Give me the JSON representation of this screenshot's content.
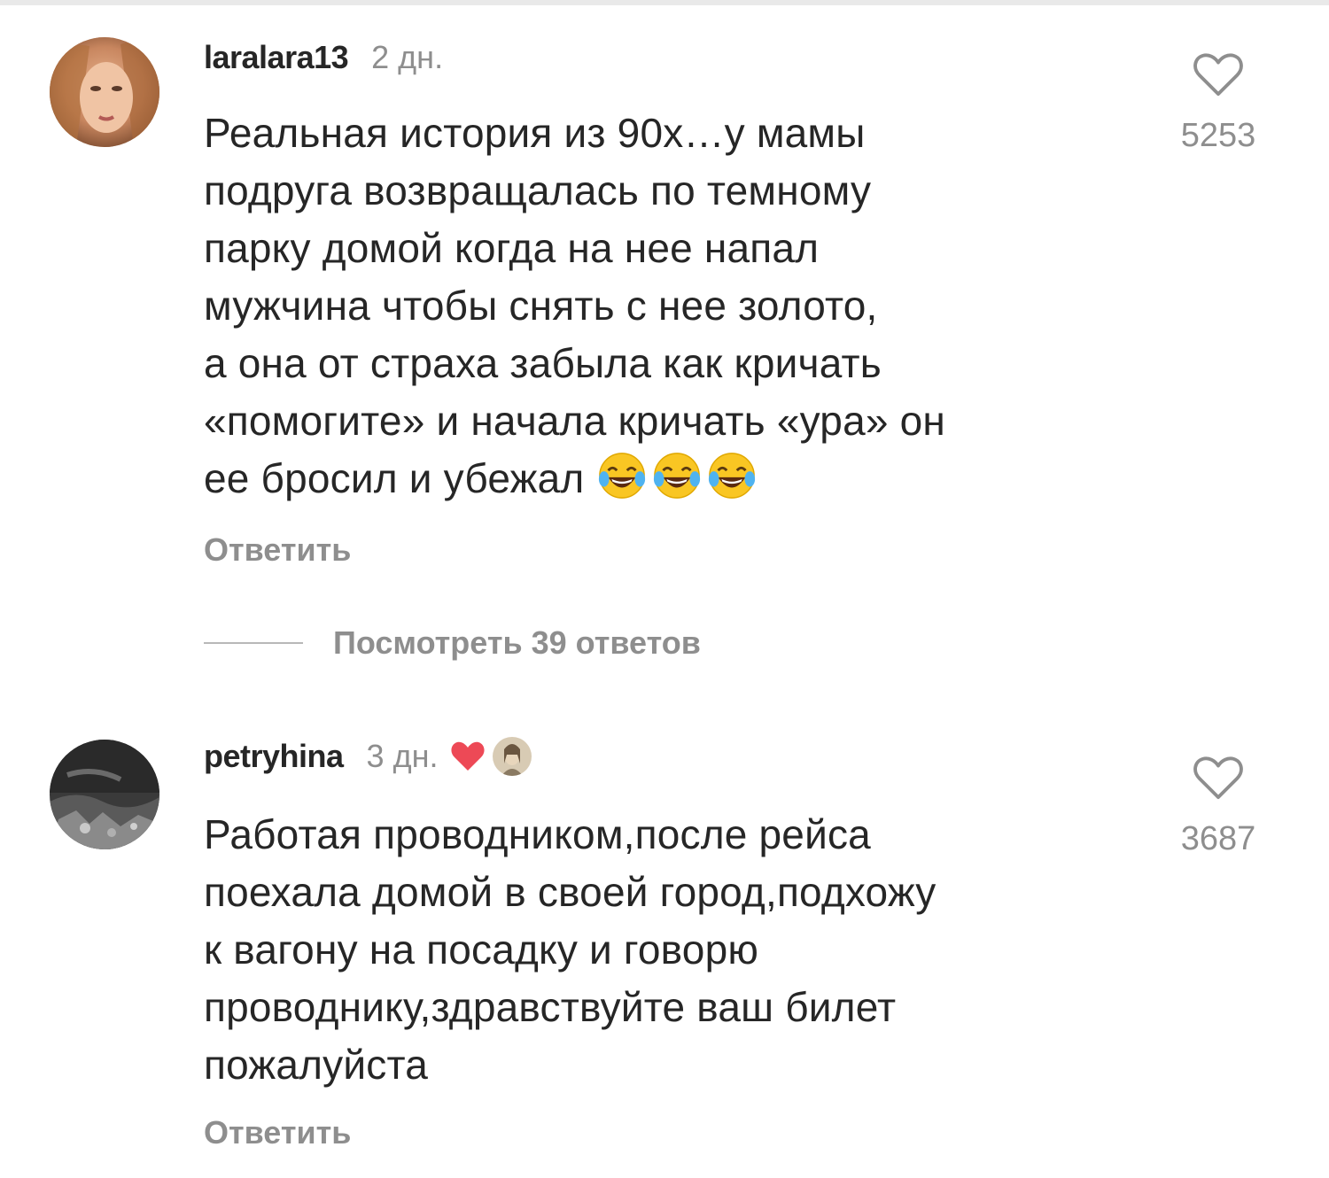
{
  "comments": [
    {
      "username": "laralara13",
      "time": "2 дн.",
      "text": "Реальная история из 90х…у мамы\nподруга возвращалась по темному\nпарку домой когда на нее напал\nмужчина чтобы снять с нее золото,\nа она от страха забыла как кричать\n«помогите» и начала кричать «ура» он\nее бросил и убежал",
      "emoji": [
        "face-with-tears-of-joy",
        "face-with-tears-of-joy",
        "face-with-tears-of-joy"
      ],
      "likes": "5253",
      "reply_label": "Ответить",
      "view_replies_label": "Посмотреть 39 ответов"
    },
    {
      "username": "petryhina",
      "time": "3 дн.",
      "author_liked": true,
      "text": "Работая проводником,после рейса\nпоехала домой в своей город,подхожу\nк вагону на посадку и говорю\nпроводнику,здравствуйте ваш билет\nпожалуйста",
      "likes": "3687",
      "reply_label": "Ответить"
    }
  ],
  "colors": {
    "text": "#262626",
    "secondary": "#8e8e8e",
    "author_heart": "#ed4956"
  },
  "icons": {
    "like": "heart-outline-icon",
    "author_like": "heart-filled-icon",
    "emoji": "face-with-tears-of-joy-icon"
  }
}
